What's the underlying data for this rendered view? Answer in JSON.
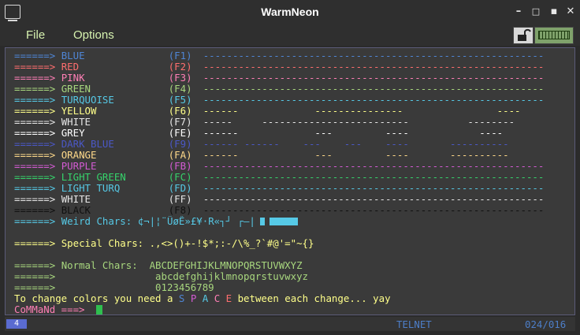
{
  "window": {
    "title": "WarmNeon",
    "icon": "terminal-icon",
    "minimize": "–",
    "maximize": "□",
    "close": "✕"
  },
  "menu": {
    "file": "File",
    "options": "Options"
  },
  "toolbar": {
    "lock_icon": "lock-icon",
    "keyboard_icon": "keyboard-icon"
  },
  "colors": {
    "blue": "#4f86d6",
    "red": "#ff6e6e",
    "pink": "#ff7fb6",
    "green": "#a8d77e",
    "turquoise": "#56c9e6",
    "yellow": "#ffff8a",
    "white": "#e6e6e6",
    "grey": "#ffffff",
    "dark_blue": "#4b58c6",
    "orange": "#ffd98a",
    "purple": "#d35bd3",
    "light_green": "#35d36b",
    "light_turq": "#56c9e6",
    "black": "#111111",
    "key": "#ff9d6e"
  },
  "terminal": {
    "rows": [
      {
        "arrow": "======>",
        "label": "BLUE",
        "key": "(F1)",
        "dashes": "----------------------------------------------------------",
        "color": "#4f86d6"
      },
      {
        "arrow": "======>",
        "label": "RED",
        "key": "(F2)",
        "dashes": "----------------------------------------------------------",
        "color": "#ff6e6e"
      },
      {
        "arrow": "======>",
        "label": "PINK",
        "key": "(F3)",
        "dashes": "----------------------------------------------------------",
        "color": "#ff7fb6"
      },
      {
        "arrow": "======>",
        "label": "GREEN",
        "key": "(F4)",
        "dashes": "----------------------------------------------------------",
        "color": "#a8d77e"
      },
      {
        "arrow": "======>",
        "label": "TURQUOISE",
        "key": "(F5)",
        "dashes": "----------------------------------------------------------",
        "color": "#56c9e6"
      },
      {
        "arrow": "======>",
        "label": "YELLOW",
        "key": "(F6)",
        "dashes": "------             ---------------                ----",
        "color": "#ffff8a"
      },
      {
        "arrow": "======>",
        "label": "WHITE",
        "key": "(F7)",
        "dashes": "-----     -------------------------          --------",
        "color": "#e6e6e6"
      },
      {
        "arrow": "======>",
        "label": "GREY",
        "key": "(FE)",
        "dashes": "------             ---         ----            ----",
        "color": "#ffffff"
      },
      {
        "arrow": "======>",
        "label": "DARK BLUE",
        "key": "(F9)",
        "dashes": "------ ------    ---    ---    ----       ----------",
        "color": "#4b58c6"
      },
      {
        "arrow": "======>",
        "label": "ORANGE",
        "key": "(FA)",
        "dashes": "------             ---         ----       ----------",
        "color": "#ffd98a"
      },
      {
        "arrow": "======>",
        "label": "PURPLE",
        "key": "(FB)",
        "dashes": "----------------------------------------------------------",
        "color": "#d35bd3"
      },
      {
        "arrow": "======>",
        "label": "LIGHT GREEN",
        "key": "(FC)",
        "dashes": "----------------------------------------------------------",
        "color": "#35d36b"
      },
      {
        "arrow": "======>",
        "label": "LIGHT TURQ",
        "key": "(FD)",
        "dashes": "----------------------------------------------------------",
        "color": "#56c9e6"
      },
      {
        "arrow": "======>",
        "label": "WHITE",
        "key": "(FF)",
        "dashes": "----------------------------------------------------------",
        "color": "#e6e6e6"
      },
      {
        "arrow": "======>",
        "label": "BLACK",
        "key": "(F8)",
        "dashes": "----------------------------------------------------------",
        "color": "#111111"
      }
    ],
    "weird_arrow": "======>",
    "weird_label": "Weird Chars:",
    "weird_chars": "¢¬|¦¨ÜøÊ»£¥·R«┐┘ ┌—|",
    "special_arrow": "======>",
    "special_label": "Special Chars:",
    "special_chars": ".,<>()+-!$*;:-/\\%_?`#@'=\"~{}",
    "normal_arrow": "======>",
    "normal_label": "Normal Chars:",
    "normal_upper": "ABCDEFGHIJKLMNOPQRSTUVWXYZ",
    "normal_arrow2": "======>",
    "normal_lower": "abcdefghijklmnopqrstuvwxyz",
    "normal_arrow3": "======>",
    "normal_digits": "0123456789",
    "hint_before": "To change colors you need a",
    "hint_space": [
      "S",
      "P",
      "A",
      "C",
      "E"
    ],
    "hint_after": "between each change... yay",
    "prompt": "CoMMaNd ===>"
  },
  "status": {
    "mode": "TELNET",
    "position": "024/016",
    "icon_glyph": "4"
  }
}
